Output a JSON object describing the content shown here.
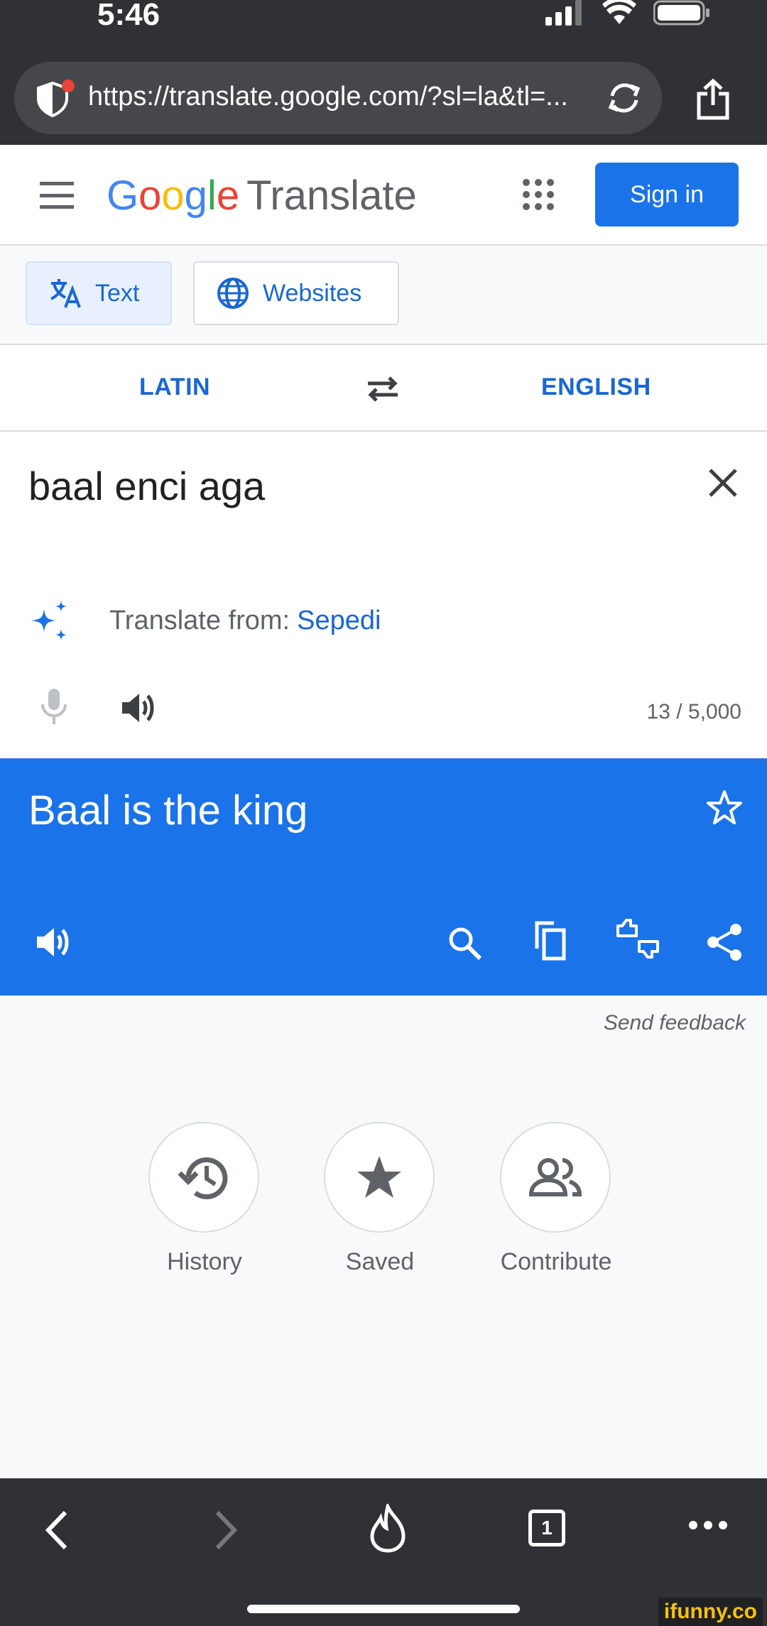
{
  "status_bar": {
    "time": "5:46"
  },
  "browser": {
    "url": "https://translate.google.com/?sl=la&tl=..."
  },
  "header": {
    "logo_letters": [
      "G",
      "o",
      "o",
      "g",
      "l",
      "e"
    ],
    "product": "Translate",
    "sign_in": "Sign in"
  },
  "modes": {
    "text": "Text",
    "websites": "Websites"
  },
  "languages": {
    "source": "LATIN",
    "target": "ENGLISH"
  },
  "source": {
    "text": "baal enci aga",
    "detect_label": "Translate from:",
    "detect_lang": "Sepedi",
    "char_count": "13 / 5,000"
  },
  "result": {
    "text": "Baal is the king"
  },
  "feedback": "Send feedback",
  "shortcuts": {
    "history": "History",
    "saved": "Saved",
    "contribute": "Contribute"
  },
  "toolbar": {
    "tabs_count": "1"
  },
  "watermark": "ifunny.co",
  "colors": {
    "brand_blue": "#1a73e8",
    "chrome_dark": "#303134",
    "link_blue": "#1967d2"
  }
}
